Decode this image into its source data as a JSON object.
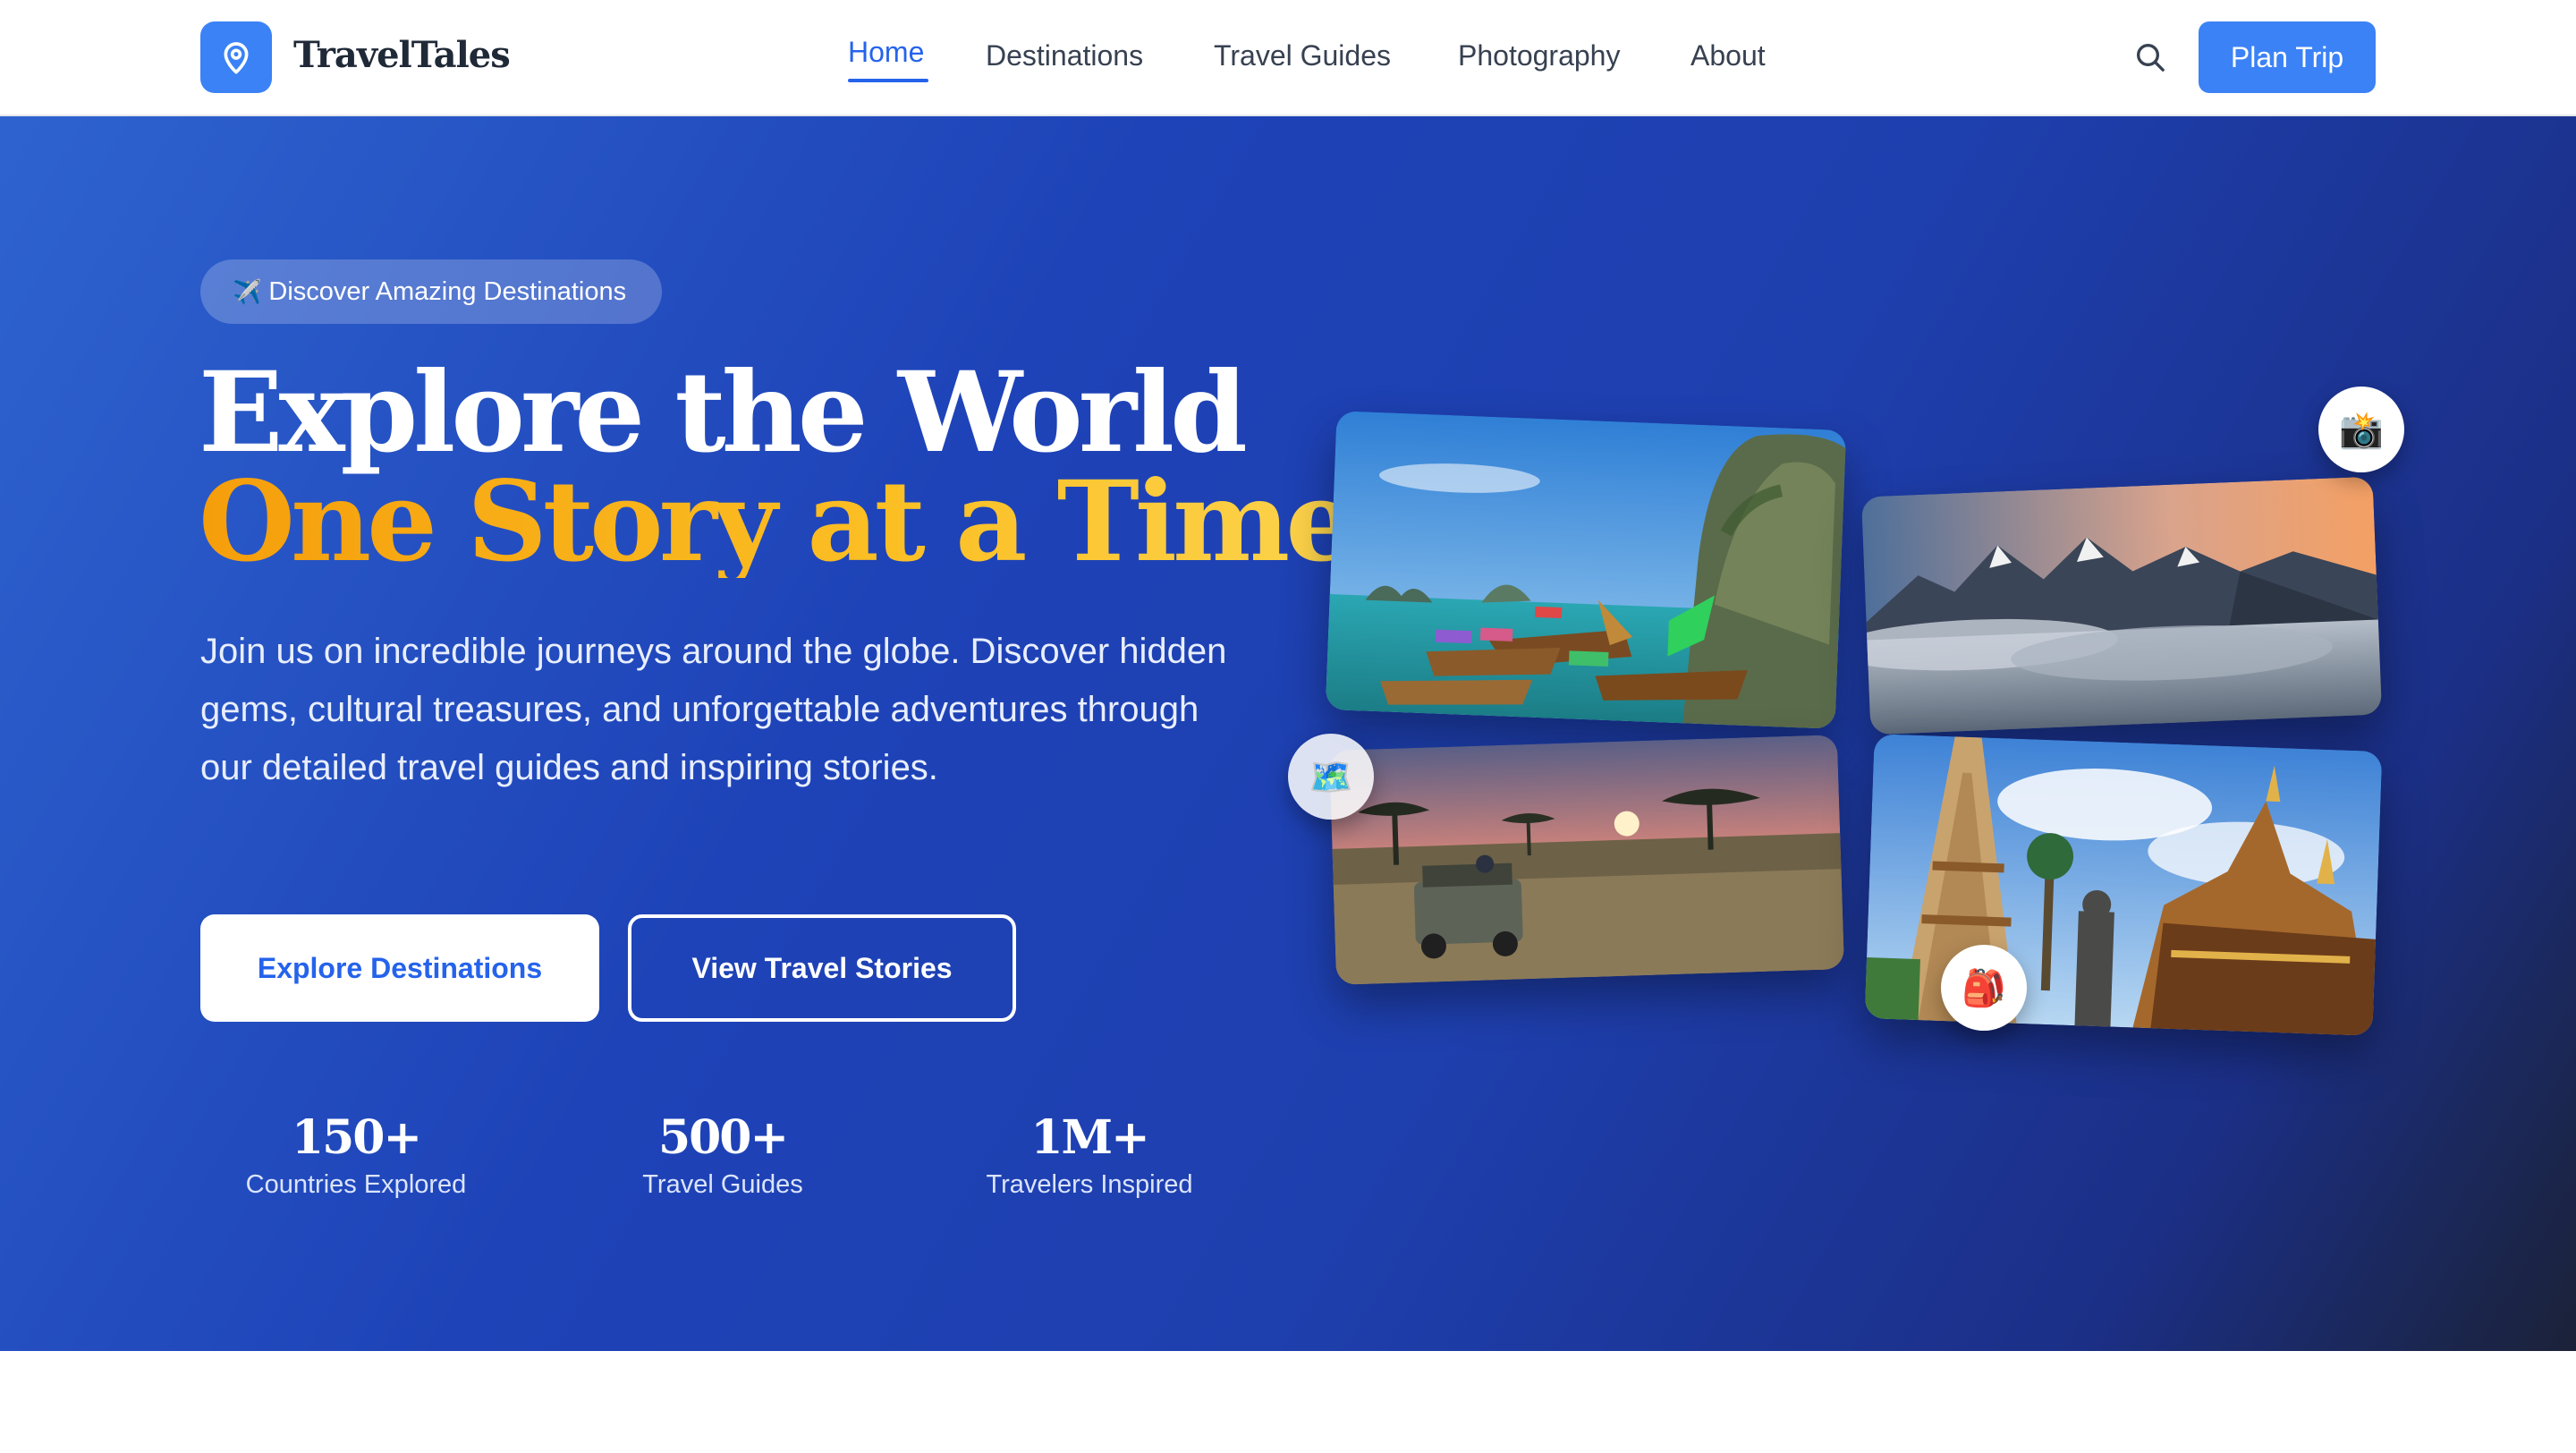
{
  "brand": {
    "name": "TravelTales",
    "logo_icon": "map-pin-icon",
    "accent_color": "#3b82f6"
  },
  "nav": {
    "links": [
      {
        "label": "Home",
        "active": true
      },
      {
        "label": "Destinations",
        "active": false
      },
      {
        "label": "Travel Guides",
        "active": false
      },
      {
        "label": "Photography",
        "active": false
      },
      {
        "label": "About",
        "active": false
      }
    ],
    "search_icon": "search-icon",
    "cta_label": "Plan Trip"
  },
  "hero": {
    "pill": {
      "emoji": "✈️",
      "label": "Discover Amazing Destinations"
    },
    "title_line1": "Explore the World",
    "title_line2": "One Story at a Time",
    "title_accent_color": "#f59e0b",
    "description": "Join us on incredible journeys around the globe. Discover hidden gems, cultural treasures, and unforgettable adventures through our detailed travel guides and inspiring stories.",
    "primary_button": "Explore Destinations",
    "secondary_button": "View Travel Stories",
    "stats": [
      {
        "value": "150+",
        "label": "Countries Explored"
      },
      {
        "value": "500+",
        "label": "Travel Guides"
      },
      {
        "value": "1M+",
        "label": "Travelers Inspired"
      }
    ],
    "badges": [
      {
        "emoji": "📸",
        "icon": "camera-icon"
      },
      {
        "emoji": "🗺️",
        "icon": "map-icon"
      },
      {
        "emoji": "🎒",
        "icon": "backpack-icon"
      }
    ]
  }
}
